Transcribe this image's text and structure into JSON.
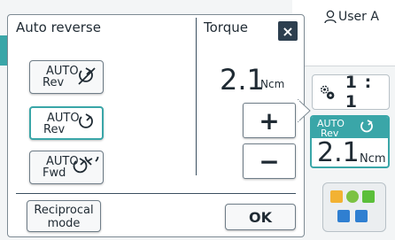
{
  "header": {
    "user_label": "User A",
    "user_icon": "person-icon"
  },
  "side": {
    "ratio": "1:1",
    "ratio_icon": "gear-icon",
    "auto_rev_card": {
      "line1": "AUTO",
      "line2": "Rev",
      "value": "2.1",
      "unit": "Ncm"
    }
  },
  "dialog": {
    "auto_reverse_title": "Auto reverse",
    "torque_title": "Torque",
    "close_label": "×",
    "buttons": [
      {
        "line1": "AUTO",
        "line2": "Rev",
        "icon": "rev-off-icon",
        "selected": false
      },
      {
        "line1": "AUTO",
        "line2": "Rev",
        "icon": "rev-arrow-icon",
        "selected": true
      },
      {
        "line1": "AUTO",
        "line2": "Fwd",
        "icon": "fwd-arrow-icon",
        "selected": false
      }
    ],
    "torque_value": "2.1",
    "torque_unit": "Ncm",
    "plus_label": "+",
    "minus_label": "−",
    "reciprocal_line1": "Reciprocal",
    "reciprocal_line2": "mode",
    "ok_label": "OK"
  },
  "colors": {
    "accent": "#3aa6a8",
    "dark": "#2d3f4f"
  }
}
